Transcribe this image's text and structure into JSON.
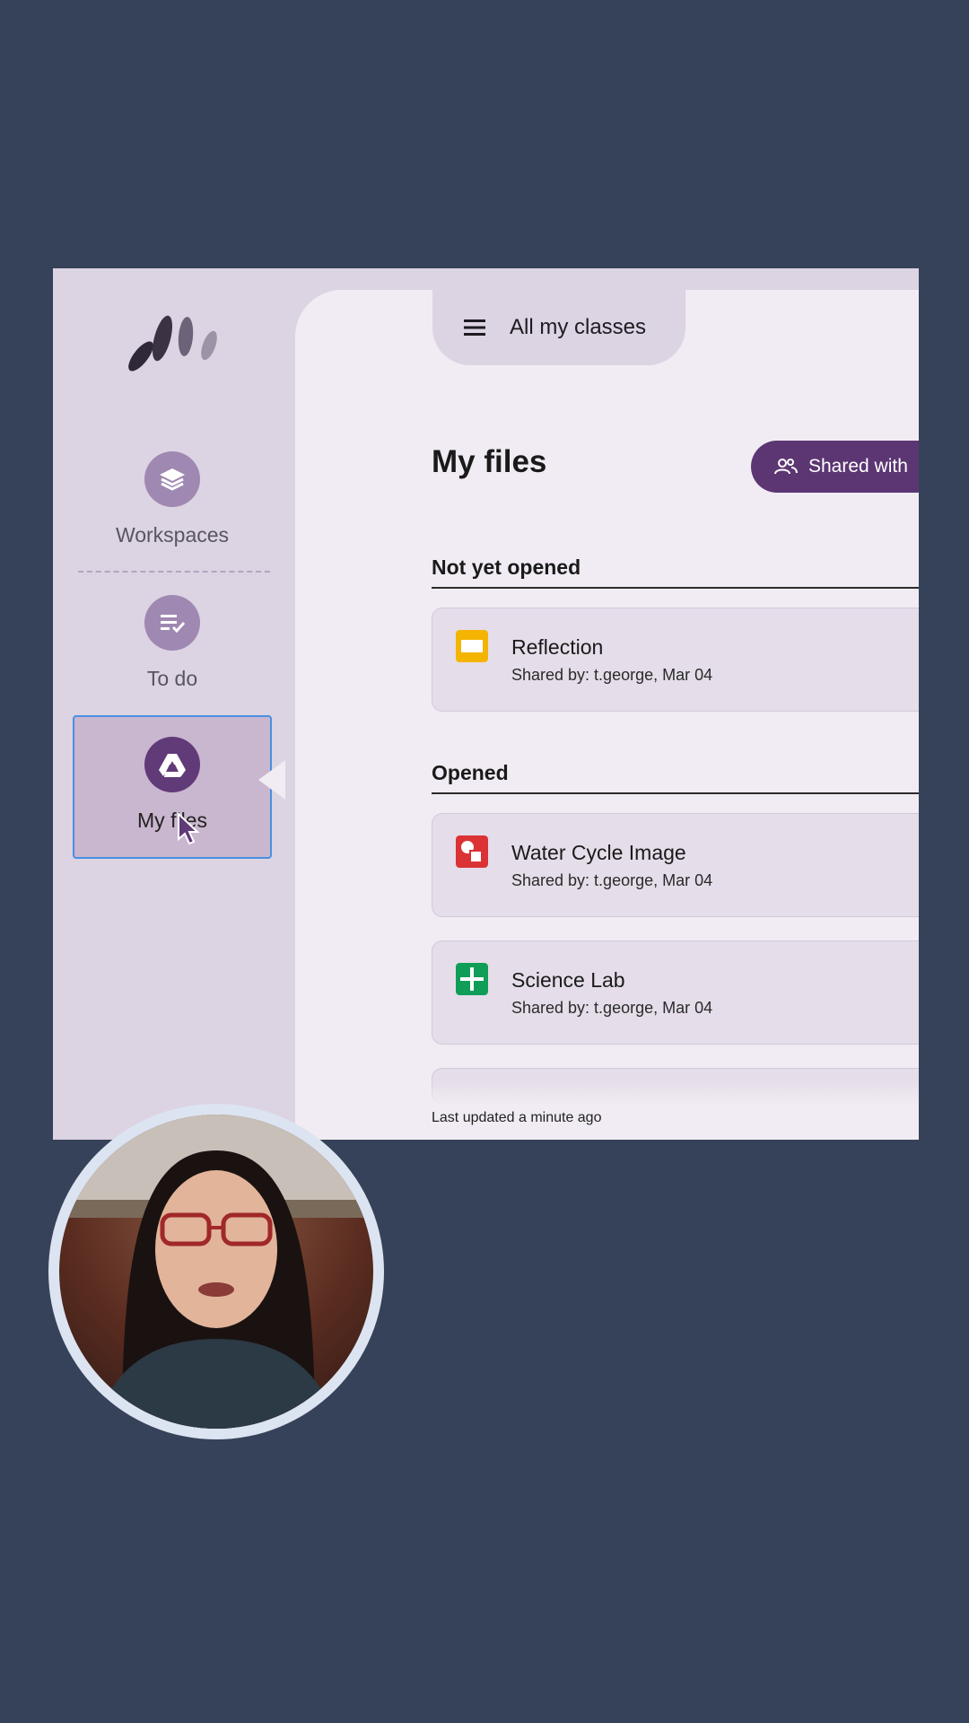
{
  "sidebar": {
    "items": [
      {
        "label": "Workspaces",
        "icon": "layers-icon"
      },
      {
        "label": "To do",
        "icon": "checklist-icon"
      },
      {
        "label": "My files",
        "icon": "drive-icon",
        "selected": true
      }
    ]
  },
  "header": {
    "menu_label": "All my classes"
  },
  "main": {
    "title": "My files",
    "shared_button": "Shared with",
    "sections": [
      {
        "title": "Not yet opened",
        "files": [
          {
            "name": "Reflection",
            "meta": "Shared by: t.george, Mar 04",
            "type": "slides",
            "color": "#f4b400"
          }
        ]
      },
      {
        "title": "Opened",
        "files": [
          {
            "name": "Water Cycle Image",
            "meta": "Shared by: t.george, Mar 04",
            "type": "drawing",
            "color": "#db3236"
          },
          {
            "name": "Science Lab",
            "meta": "Shared by: t.george, Mar 04",
            "type": "sheets",
            "color": "#0f9d58"
          }
        ]
      }
    ],
    "footer": "Last updated a minute ago"
  },
  "colors": {
    "background": "#364259",
    "sidebar": "#dcd3e3",
    "content": "#f1ecf3",
    "accent": "#5c3673",
    "selection_border": "#4a90e2"
  }
}
